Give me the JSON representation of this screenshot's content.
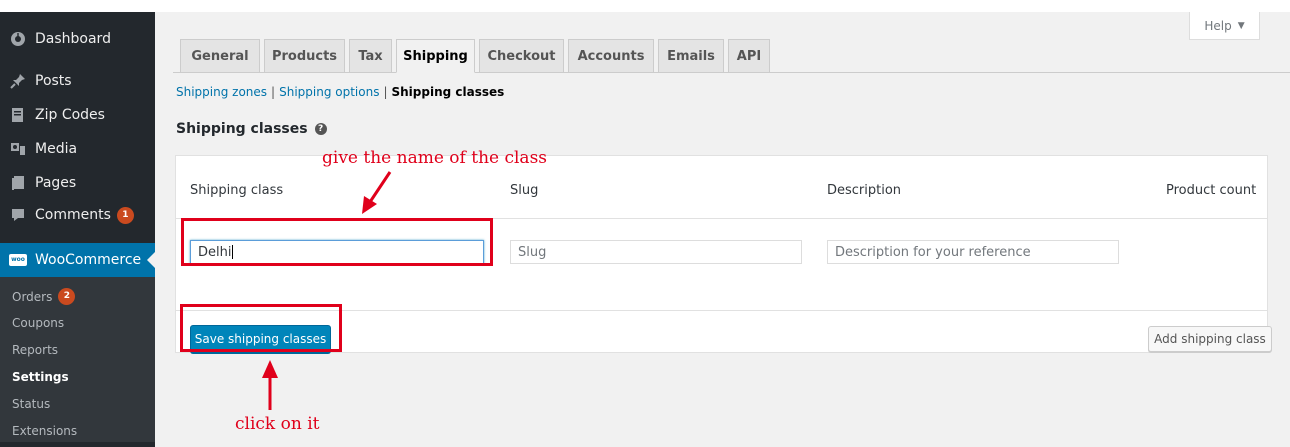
{
  "sidebar": {
    "items": [
      {
        "label": "Dashboard",
        "icon": "dashboard-icon"
      },
      {
        "label": "Posts",
        "icon": "pin-icon"
      },
      {
        "label": "Zip Codes",
        "icon": "document-icon"
      },
      {
        "label": "Media",
        "icon": "media-icon"
      },
      {
        "label": "Pages",
        "icon": "pages-icon"
      },
      {
        "label": "Comments",
        "icon": "comment-icon",
        "badge": "1"
      },
      {
        "label": "WooCommerce",
        "icon": "woo-icon"
      }
    ],
    "woo_badge_text": "woo",
    "submenu": [
      {
        "label": "Orders",
        "badge": "2"
      },
      {
        "label": "Coupons"
      },
      {
        "label": "Reports"
      },
      {
        "label": "Settings"
      },
      {
        "label": "Status"
      },
      {
        "label": "Extensions"
      }
    ]
  },
  "help": {
    "label": "Help"
  },
  "tabs": [
    "General",
    "Products",
    "Tax",
    "Shipping",
    "Checkout",
    "Accounts",
    "Emails",
    "API"
  ],
  "subsubsub": {
    "zones": "Shipping zones",
    "options": "Shipping options",
    "classes": "Shipping classes",
    "separator": "|"
  },
  "section": {
    "title": "Shipping classes",
    "help_icon": "?"
  },
  "table": {
    "headers": [
      "Shipping class",
      "Slug",
      "Description",
      "Product count"
    ],
    "row": {
      "class_value": "Delhi",
      "slug_placeholder": "Slug",
      "description_placeholder": "Description for your reference"
    },
    "save_button": "Save shipping classes",
    "add_button": "Add shipping class"
  },
  "annotations": {
    "top": "give the name of the class",
    "bottom": "click on it"
  },
  "colors": {
    "sidebar_bg": "#23282d",
    "active_menu": "#0073aa",
    "primary_button": "#0085ba",
    "annotation": "#e0001b",
    "badge": "#ca4a1f"
  }
}
